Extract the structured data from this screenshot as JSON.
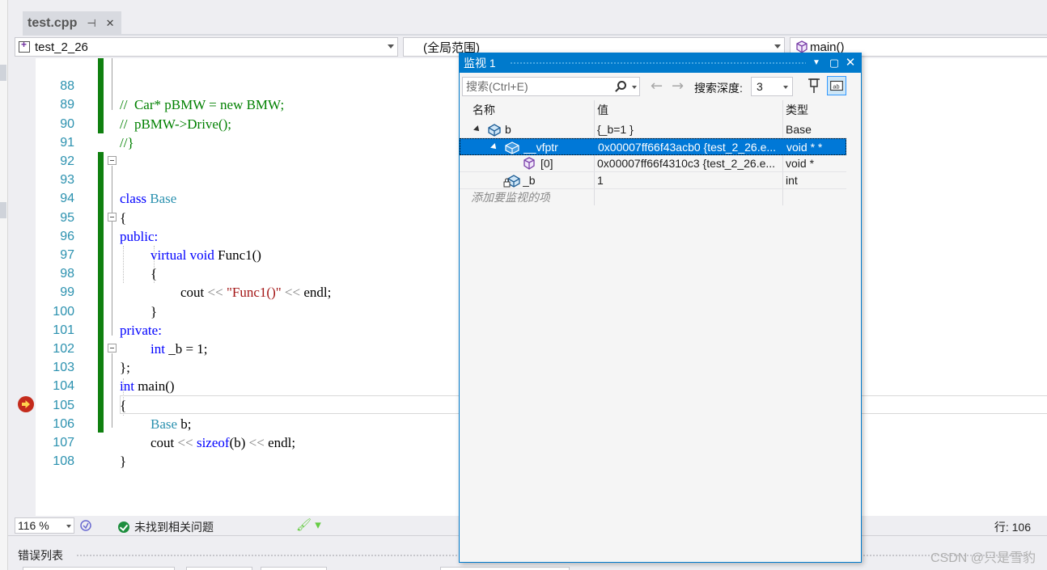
{
  "tab": {
    "title": "test.cpp",
    "pin": "⊣",
    "close": "✕"
  },
  "navbar": {
    "project": "test_2_26",
    "scope": "(全局范围)",
    "function": "main()"
  },
  "code": {
    "lines": [
      {
        "n": "88"
      },
      {
        "n": "89"
      },
      {
        "n": "90"
      },
      {
        "n": "91"
      },
      {
        "n": "92"
      },
      {
        "n": "93"
      },
      {
        "n": "94"
      },
      {
        "n": "95"
      },
      {
        "n": "96"
      },
      {
        "n": "97"
      },
      {
        "n": "98"
      },
      {
        "n": "99"
      },
      {
        "n": "100"
      },
      {
        "n": "101"
      },
      {
        "n": "102"
      },
      {
        "n": "103"
      },
      {
        "n": "104"
      },
      {
        "n": "105"
      },
      {
        "n": "106"
      },
      {
        "n": "107"
      },
      {
        "n": "108"
      }
    ],
    "t88a": "//  Car* pBMW = new BMW;",
    "t89a": "//  pBMW->Drive();",
    "t90a": "//}",
    "t93_kw": "class",
    "t93_ty": "Base",
    "t94": "{",
    "t95": "public:",
    "t96_kw1": "virtual",
    "t96_kw2": "void",
    "t96_fn": "Func1()",
    "t97": "{",
    "t98_a": "cout",
    "t98_op1": "<<",
    "t98_str": "\"Func1()\"",
    "t98_op2": "<<",
    "t98_b": "endl;",
    "t99": "}",
    "t100": "private:",
    "t101_kw": "int",
    "t101_rest": "_b = 1;",
    "t102": "};",
    "t103_kw": "int",
    "t103_rest": "main()",
    "t104": "{",
    "t105_ty": "Base",
    "t105_rest": "b;",
    "t106_a": "cout",
    "t106_op1": "<<",
    "t106_kw": "sizeof",
    "t106_b": "(b)",
    "t106_op2": "<<",
    "t106_c": "endl;",
    "t107": "}"
  },
  "status": {
    "zoom": "116 %",
    "health": "未找到相关问题",
    "position": "行: 106"
  },
  "errors": {
    "title": "错误列表"
  },
  "watch": {
    "title": "监视 1",
    "search_placeholder": "搜索(Ctrl+E)",
    "back": "←",
    "forward": "→",
    "depth_label": "搜索深度:",
    "depth_value": "3",
    "columns": {
      "name": "名称",
      "value": "值",
      "type": "类型"
    },
    "rows": [
      {
        "name": "b",
        "value": "{_b=1 }",
        "type": "Base"
      },
      {
        "name": "__vfptr",
        "value": "0x00007ff66f43acb0 {test_2_26.e...",
        "type": "void * *"
      },
      {
        "name": "[0]",
        "value": "0x00007ff66f4310c3 {test_2_26.e...",
        "type": "void *"
      },
      {
        "name": "_b",
        "value": "1",
        "type": "int"
      }
    ],
    "add_item": "添加要监视的项",
    "btn_dropdown": "▼",
    "btn_maximize": "▢",
    "btn_close": "✕"
  },
  "watermark": "CSDN @只是雪豹",
  "colors": {
    "accent": "#007acc",
    "selection": "#0078d7",
    "keyword": "#0000ff",
    "type": "#2b91af",
    "comment": "#008000",
    "string": "#a31515",
    "change_bar": "#108010"
  }
}
